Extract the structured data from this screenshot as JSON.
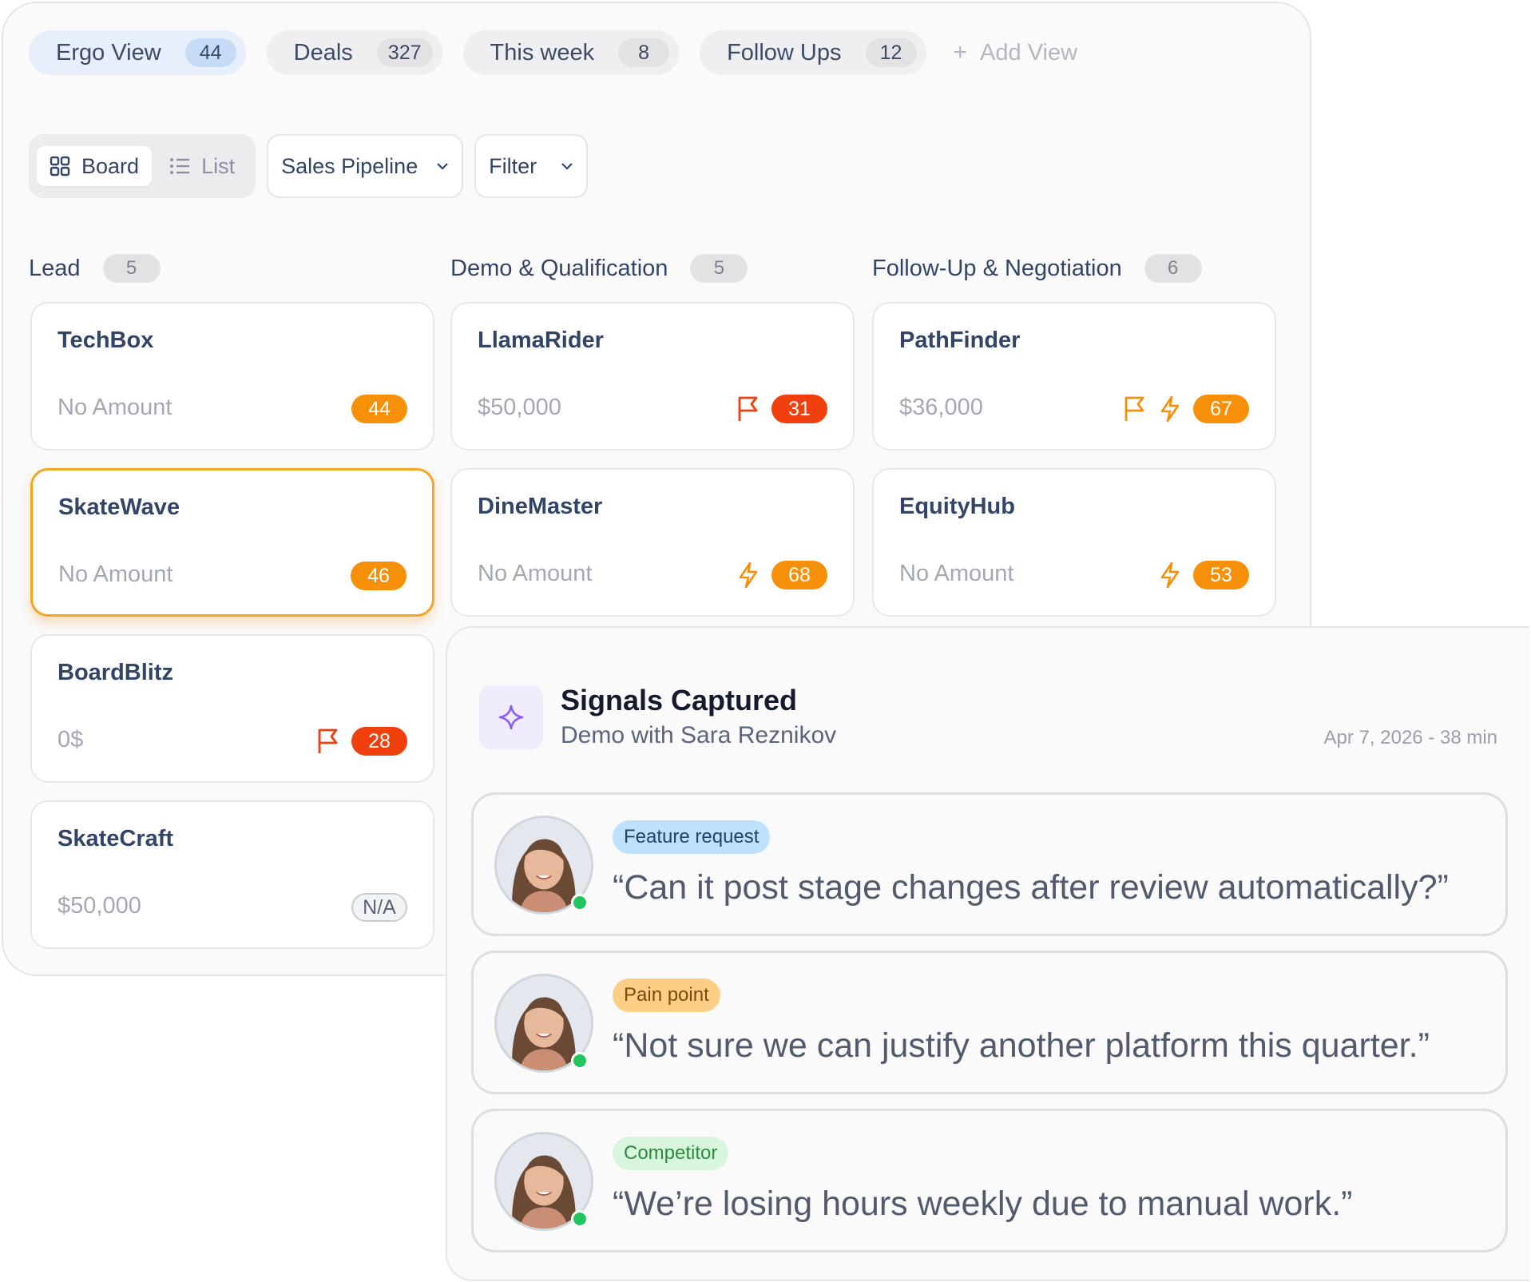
{
  "tabs": [
    {
      "label": "Ergo View",
      "count": "44"
    },
    {
      "label": "Deals",
      "count": "327"
    },
    {
      "label": "This week",
      "count": "8"
    },
    {
      "label": "Follow Ups",
      "count": "12"
    }
  ],
  "add_view_label": "Add View",
  "toolbar": {
    "board_label": "Board",
    "list_label": "List",
    "pipeline_value": "Sales Pipeline",
    "filter_label": "Filter"
  },
  "columns": [
    {
      "title": "Lead",
      "count": "5",
      "cards": [
        {
          "name": "TechBox",
          "amount": "No Amount",
          "score": "44"
        },
        {
          "name": "SkateWave",
          "amount": "No Amount",
          "score": "46"
        },
        {
          "name": "BoardBlitz",
          "amount": "0$",
          "score": "28"
        },
        {
          "name": "SkateCraft",
          "amount": "$50,000",
          "score": "N/A"
        }
      ]
    },
    {
      "title": "Demo & Qualification",
      "count": "5",
      "cards": [
        {
          "name": "LlamaRider",
          "amount": "$50,000",
          "score": "31"
        },
        {
          "name": "DineMaster",
          "amount": "No Amount",
          "score": "68"
        }
      ]
    },
    {
      "title": "Follow-Up & Negotiation",
      "count": "6",
      "cards": [
        {
          "name": "PathFinder",
          "amount": "$36,000",
          "score": "67"
        },
        {
          "name": "EquityHub",
          "amount": "No Amount",
          "score": "53"
        }
      ]
    }
  ],
  "signals": {
    "title": "Signals Captured",
    "subtitle": "Demo with Sara Reznikov",
    "meta": "Apr 7, 2026 - 38 min",
    "items": [
      {
        "tag": "Feature request",
        "quote": "“Can it post stage changes after review automatically?”"
      },
      {
        "tag": "Pain point",
        "quote": "“Not sure we can justify another platform this quarter.”"
      },
      {
        "tag": "Competitor",
        "quote": "“We’re losing hours weekly due to manual work.”"
      }
    ]
  },
  "colors": {
    "orange": "#f79009",
    "red": "#f0400d",
    "selected_border": "#f5a524",
    "accent_purple": "#8b5cf6",
    "online": "#22c55e"
  },
  "icons": [
    "plus-icon",
    "grid-icon",
    "list-icon",
    "chevron-down-icon",
    "flag-icon",
    "lightning-icon",
    "sparkle-icon"
  ]
}
